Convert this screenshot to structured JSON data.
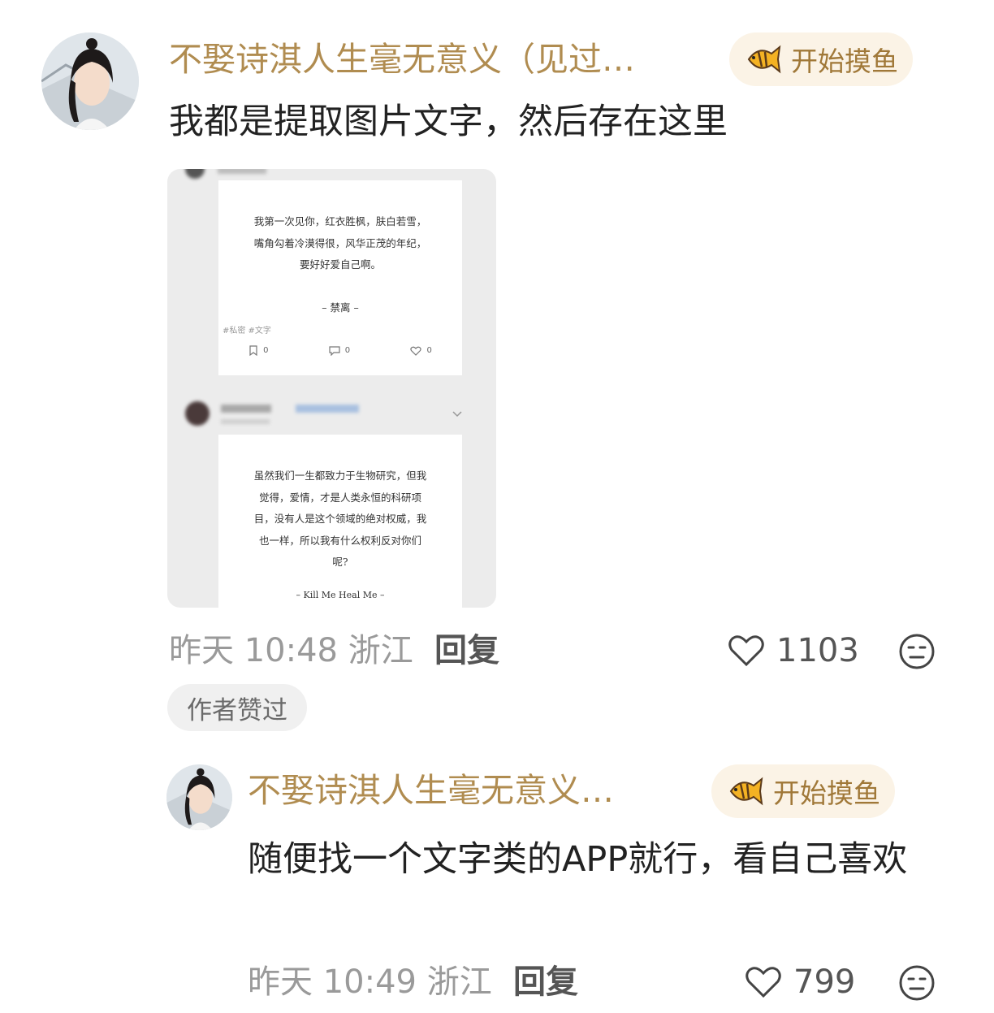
{
  "comments": [
    {
      "username": "不娶诗淇人生毫无意义（见过…",
      "badge": "开始摸鱼",
      "text": "我都是提取图片文字，然后存在这里",
      "time": "昨天 10:48",
      "location": "浙江",
      "reply_label": "回复",
      "likes": "1103",
      "author_liked": "作者赞过"
    },
    {
      "username": "不娶诗淇人生毫无意义…",
      "badge": "开始摸鱼",
      "text": "随便找一个文字类的APP就行，看自己喜欢",
      "time": "昨天 10:49",
      "location": "浙江",
      "reply_label": "回复",
      "likes": "799"
    }
  ],
  "attachment": {
    "card1": {
      "lines": [
        "我第一次见你，红衣胜枫，肤白若雪，",
        "嘴角勾着冷漠得很，风华正茂的年纪，",
        "要好好爱自己啊。"
      ],
      "signature": "– 禁离 –",
      "tags": "#私密 #文字",
      "stats": {
        "save": "0",
        "comment": "0",
        "like": "0"
      }
    },
    "card2": {
      "lines": [
        "虽然我们一生都致力于生物研究，但我",
        "觉得，爱情，才是人类永恒的科研项",
        "目，没有人是这个领域的绝对权威，我",
        "也一样，所以我有什么权利反对你们",
        "呢?"
      ],
      "signature": "– Kill Me Heal Me –"
    }
  },
  "colors": {
    "username": "#b08c50",
    "badge_bg": "#fbf3e6",
    "meta": "#9a9a9a"
  },
  "icons": [
    "fish-icon",
    "heart-icon",
    "neutral-face-icon",
    "bookmark-icon",
    "comment-icon"
  ]
}
